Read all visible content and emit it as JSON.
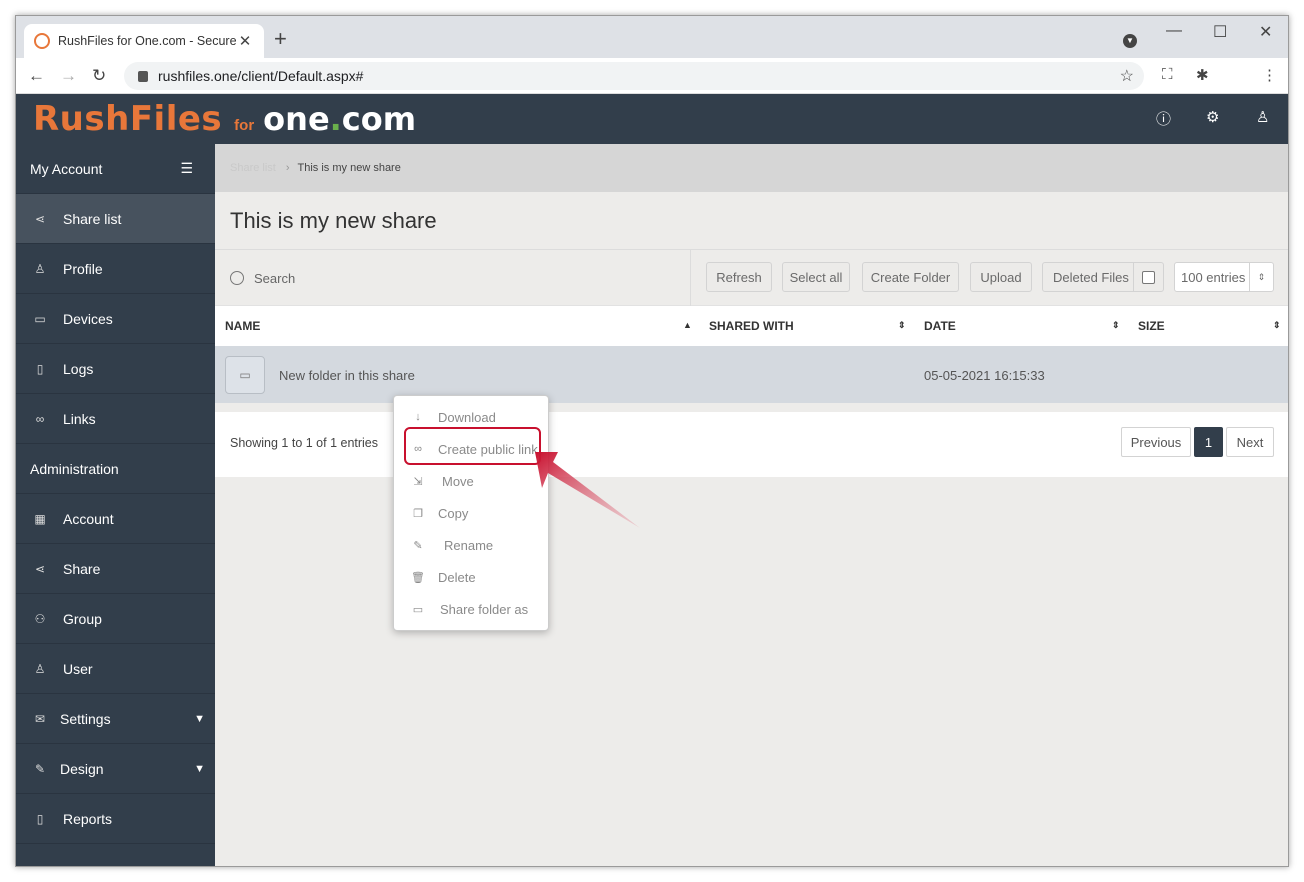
{
  "browser": {
    "tab_title": "RushFiles for One.com - Securely",
    "tab_close": "✕",
    "new_tab": "+",
    "url": "rushfiles.one/client/Default.aspx#",
    "back": "←",
    "forward": "→",
    "reload": "↻",
    "star": "☆",
    "minimize": "—",
    "maximize": "☐",
    "close": "✕"
  },
  "header": {
    "logo_main": "RushFiles",
    "logo_for": "for",
    "logo_one": "one",
    "logo_dot": ".",
    "logo_com": "com",
    "info_icon": "ⓘ",
    "settings_icon": "⚙",
    "user_icon": "♙"
  },
  "sidebar": {
    "my_account": "My Account",
    "items": [
      {
        "label": "Share list",
        "icon": "share-icon",
        "glyph": "⋖"
      },
      {
        "label": "Profile",
        "icon": "person-icon",
        "glyph": "♙"
      },
      {
        "label": "Devices",
        "icon": "devices-icon",
        "glyph": "▭"
      },
      {
        "label": "Logs",
        "icon": "log-icon",
        "glyph": "▯"
      },
      {
        "label": "Links",
        "icon": "link-icon",
        "glyph": "∞"
      }
    ],
    "administration": "Administration",
    "admin_items": [
      {
        "label": "Account",
        "icon": "building-icon",
        "glyph": "▦"
      },
      {
        "label": "Share",
        "icon": "share-icon",
        "glyph": "⋖"
      },
      {
        "label": "Group",
        "icon": "group-icon",
        "glyph": "⚇"
      },
      {
        "label": "User",
        "icon": "person-icon",
        "glyph": "♙"
      },
      {
        "label": "Settings",
        "icon": "envelope-icon",
        "glyph": "✉"
      },
      {
        "label": "Design",
        "icon": "pencil-icon",
        "glyph": "✎"
      },
      {
        "label": "Reports",
        "icon": "report-icon",
        "glyph": "▯"
      }
    ]
  },
  "main": {
    "breadcrumb_root": "Share list",
    "breadcrumb_sep": "›",
    "breadcrumb_current": "This is my new share",
    "title": "This is my new share",
    "search_placeholder": "Search",
    "buttons": {
      "refresh": "Refresh",
      "select_all": "Select all",
      "create_folder": "Create Folder",
      "upload": "Upload",
      "deleted_files": "Deleted Files",
      "entries": "100 entries"
    },
    "columns": {
      "name": "NAME",
      "shared_with": "SHARED WITH",
      "date": "DATE",
      "size": "SIZE"
    },
    "rows": [
      {
        "name": "New folder in this share",
        "shared_with": "",
        "date": "05-05-2021 16:15:33",
        "size": ""
      }
    ],
    "showing": "Showing 1 to 1 of 1 entries",
    "pagination": {
      "previous": "Previous",
      "current": "1",
      "next": "Next"
    }
  },
  "context_menu": [
    {
      "label": "Download",
      "icon": "download-icon",
      "glyph": "↓"
    },
    {
      "label": "Create public link",
      "icon": "link-icon",
      "glyph": "∞"
    },
    {
      "label": "Move",
      "icon": "move-icon",
      "glyph": "⇲"
    },
    {
      "label": "Copy",
      "icon": "copy-icon",
      "glyph": "❐"
    },
    {
      "label": "Rename",
      "icon": "rename-icon",
      "glyph": "✎"
    },
    {
      "label": "Delete",
      "icon": "trash-icon",
      "glyph": "🗑"
    },
    {
      "label": "Share folder as",
      "icon": "folder-icon",
      "glyph": "▭"
    }
  ],
  "colors": {
    "brand_orange": "#e8773a",
    "nav_dark": "#323e4b",
    "highlight_red": "#c8102e"
  }
}
